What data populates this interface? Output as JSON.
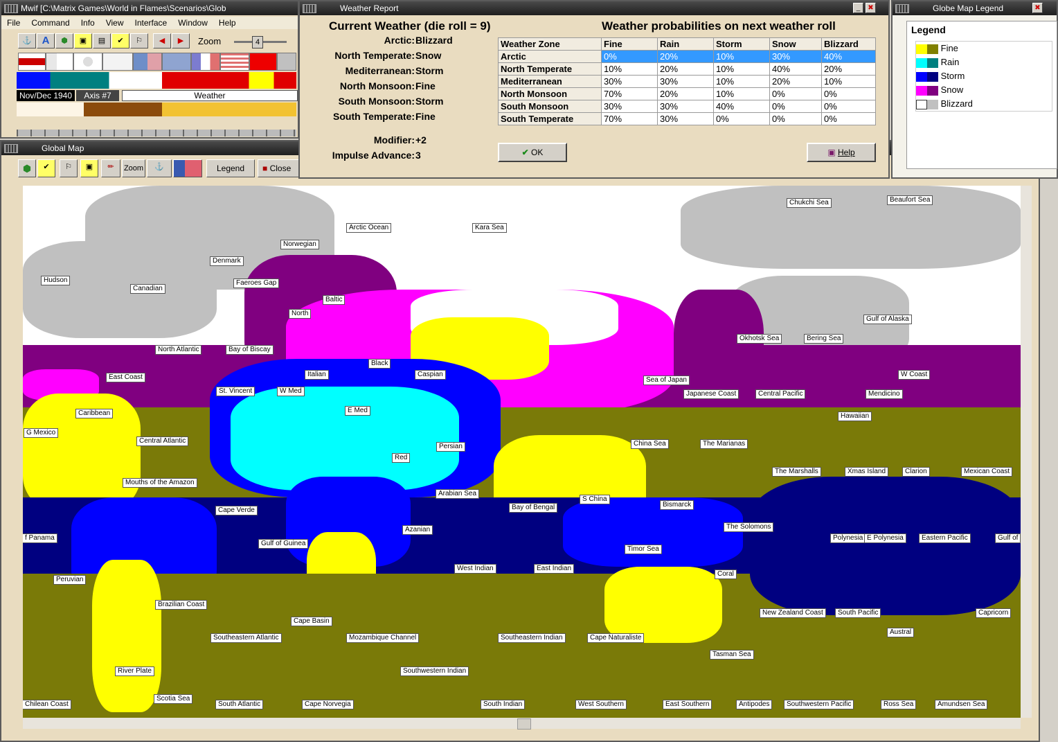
{
  "main_window": {
    "title": "Mwif [C:\\Matrix Games\\World in Flames\\Scenarios\\Glob",
    "menu": [
      "File",
      "Command",
      "Info",
      "View",
      "Interface",
      "Window",
      "Help"
    ],
    "zoom_label": "Zoom",
    "zoom_value": "4",
    "date": "Nov/Dec 1940",
    "turn": "Axis #7",
    "phase": "Weather"
  },
  "global_map": {
    "title": "Global Map",
    "zoom_button": "Zoom",
    "legend_button": "Legend",
    "close_button": "Close",
    "sea_labels": [
      "Arctic Ocean",
      "Kara Sea",
      "Chukchi Sea",
      "Beaufort Sea",
      "Norwegian",
      "Denmark",
      "Hudson",
      "Canadian",
      "Faeroes Gap",
      "Baltic",
      "North",
      "North Atlantic",
      "Bay of Biscay",
      "Black",
      "East Coast",
      "Italian",
      "Caspian",
      "St. Vincent",
      "W Med",
      "Sea of Japan",
      "Japanese Coast",
      "Central Pacific",
      "W Coast",
      "Mendicino",
      "Caribbean",
      "E Med",
      "Hawaiian",
      "G Mexico",
      "Central Atlantic",
      "Persian",
      "China Sea",
      "The Marianas",
      "Red",
      "The Marshalls",
      "Xmas Island",
      "Clarion",
      "Mexican Coast",
      "Mouths of the Amazon",
      "Arabian Sea",
      "S China",
      "Bismarck",
      "Cape Verde",
      "Bay of Bengal",
      "Azanian",
      "The Solomons",
      "Polynesia",
      "E Polynesia",
      "Eastern Pacific",
      "Gulf of",
      "f Panama",
      "Gulf of Guinea",
      "Timor Sea",
      "West Indian",
      "East Indian",
      "Coral",
      "Peruvian",
      "Brazilian Coast",
      "New Zealand Coast",
      "South Pacific",
      "Capricorn",
      "Cape Basin",
      "Southeastern Atlantic",
      "Mozambique Channel",
      "Southeastern Indian",
      "Cape Naturaliste",
      "Austral",
      "Tasman Sea",
      "River Plate",
      "Southwestern Indian",
      "Scotia Sea",
      "Chilean Coast",
      "South Atlantic",
      "Cape Norvegia",
      "South Indian",
      "West Southern",
      "East Southern",
      "Antipodes",
      "Southwestern Pacific",
      "Ross Sea",
      "Amundsen Sea",
      "Gulf of Alaska",
      "Okhotsk Sea",
      "Bering Sea"
    ]
  },
  "weather_report": {
    "title": "Weather Report",
    "heading": "Current Weather (die roll = 9)",
    "prob_heading": "Weather probabilities on next weather roll",
    "current": [
      {
        "zone": "Arctic:",
        "weather": "Blizzard"
      },
      {
        "zone": "North Temperate:",
        "weather": "Snow"
      },
      {
        "zone": "Mediterranean:",
        "weather": "Storm"
      },
      {
        "zone": "North Monsoon:",
        "weather": "Fine"
      },
      {
        "zone": "South Monsoon:",
        "weather": "Storm"
      },
      {
        "zone": "South Temperate:",
        "weather": "Fine"
      }
    ],
    "modifier_label": "Modifier:",
    "modifier_value": "+2",
    "impulse_label": "Impulse Advance:",
    "impulse_value": "3",
    "table_headers": [
      "Weather Zone",
      "Fine",
      "Rain",
      "Storm",
      "Snow",
      "Blizzard"
    ],
    "table_rows": [
      [
        "Arctic",
        "0%",
        "20%",
        "10%",
        "30%",
        "40%"
      ],
      [
        "North Temperate",
        "10%",
        "20%",
        "10%",
        "40%",
        "20%"
      ],
      [
        "Mediterranean",
        "30%",
        "30%",
        "10%",
        "20%",
        "10%"
      ],
      [
        "North Monsoon",
        "70%",
        "20%",
        "10%",
        "0%",
        "0%"
      ],
      [
        "South Monsoon",
        "30%",
        "30%",
        "40%",
        "0%",
        "0%"
      ],
      [
        "South Temperate",
        "70%",
        "30%",
        "0%",
        "0%",
        "0%"
      ]
    ],
    "ok_button": "OK",
    "help_button": "Help"
  },
  "legend_window": {
    "title": "Globe Map Legend",
    "heading": "Legend",
    "items": [
      {
        "label": "Fine",
        "c1": "#ffff00",
        "c2": "#808000"
      },
      {
        "label": "Rain",
        "c1": "#00ffff",
        "c2": "#008080"
      },
      {
        "label": "Storm",
        "c1": "#0000ff",
        "c2": "#000080"
      },
      {
        "label": "Snow",
        "c1": "#ff00ff",
        "c2": "#800080"
      },
      {
        "label": "Blizzard",
        "c1": "#ffffff",
        "c2": "#c0c0c0"
      }
    ]
  },
  "colors": {
    "fine_light": "#ffff00",
    "fine_dark": "#7a7a08",
    "rain_light": "#00ffff",
    "storm_light": "#0000ff",
    "storm_dark": "#000080",
    "snow_light": "#ff00ff",
    "snow_dark": "#800080",
    "blizzard_light": "#ffffff",
    "blizzard_dark": "#c0c0c0",
    "selected_row": "#3399ff"
  }
}
